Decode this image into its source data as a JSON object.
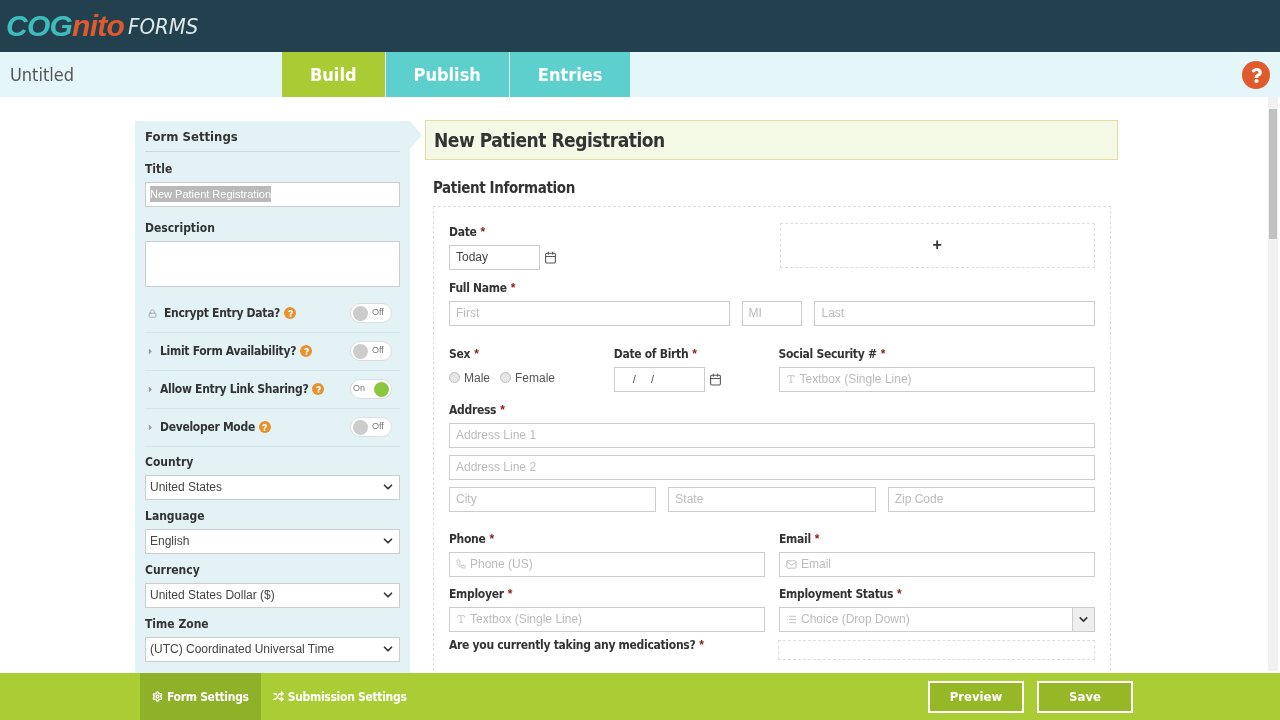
{
  "logo": {
    "brand": "COGnito",
    "suffix": "FORMS"
  },
  "form_name": "Untitled",
  "tabs": [
    {
      "label": "Build",
      "selected": true
    },
    {
      "label": "Publish",
      "selected": false
    },
    {
      "label": "Entries",
      "selected": false
    }
  ],
  "settings": {
    "heading": "Form Settings",
    "title_label": "Title",
    "title_value": "New Patient Registration",
    "description_label": "Description",
    "toggles": [
      {
        "label": "Encrypt Entry Data?",
        "kind": "lock",
        "on": false,
        "state": "Off"
      },
      {
        "label": "Limit Form Availability?",
        "kind": "caret",
        "on": false,
        "state": "Off"
      },
      {
        "label": "Allow Entry Link Sharing?",
        "kind": "caret",
        "on": true,
        "state": "On"
      },
      {
        "label": "Developer Mode",
        "kind": "caret",
        "on": false,
        "state": "Off"
      }
    ],
    "selects": [
      {
        "label": "Country",
        "value": "United States"
      },
      {
        "label": "Language",
        "value": "English"
      },
      {
        "label": "Currency",
        "value": "United States Dollar ($)"
      },
      {
        "label": "Time Zone",
        "value": "(UTC) Coordinated Universal Time"
      }
    ]
  },
  "form": {
    "title": "New Patient Registration",
    "section": "Patient Information",
    "date": {
      "label": "Date",
      "mark": "*",
      "value": "Today"
    },
    "add_field": "+",
    "full_name": {
      "label": "Full Name",
      "mark": "*",
      "placeholders": [
        "First",
        "MI",
        "Last"
      ]
    },
    "sex": {
      "label": "Sex",
      "mark": "*",
      "options": [
        {
          "label": "Male",
          "selected": false
        },
        {
          "label": "Female",
          "selected": false
        }
      ]
    },
    "dob": {
      "label": "Date of Birth",
      "mark": "*",
      "value": "/     /"
    },
    "ssn": {
      "label": "Social Security #",
      "mark": "*",
      "placeholder": "Textbox (Single Line)"
    },
    "address": {
      "label": "Address",
      "mark": "*",
      "lines": [
        "Address Line 1",
        "Address Line 2"
      ],
      "parts": [
        "City",
        "State",
        "Zip Code"
      ]
    },
    "phone": {
      "label": "Phone",
      "mark": "*",
      "placeholder": "Phone (US)"
    },
    "email": {
      "label": "Email",
      "mark": "*",
      "placeholder": "Email"
    },
    "employer": {
      "label": "Employer",
      "mark": "*",
      "placeholder": "Textbox (Single Line)"
    },
    "employment_status": {
      "label": "Employment Status",
      "mark": "*",
      "placeholder": "Choice (Drop Down)"
    },
    "medications": {
      "label": "Are you currently taking any medications?",
      "mark": "*"
    }
  },
  "footer": {
    "tabs": [
      {
        "label": "Form Settings",
        "kind": "gear",
        "selected": true
      },
      {
        "label": "Submission Settings",
        "kind": "shuffle",
        "selected": false
      }
    ],
    "buttons": [
      "Preview",
      "Save"
    ]
  }
}
